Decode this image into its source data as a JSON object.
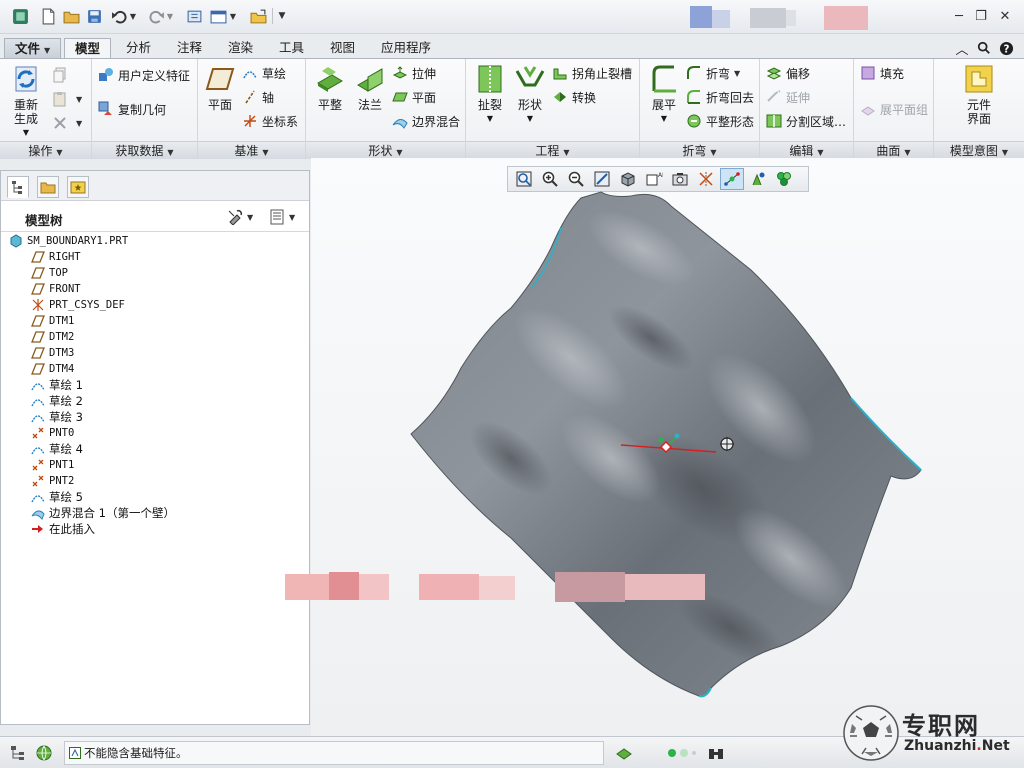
{
  "colors": {
    "accent_blue": "#2b6cb0",
    "surface_gray": "#6e747b",
    "edge_cyan": "#2ab2c8",
    "axis_red": "#d81e1e",
    "sketch_blue": "#2d7fc1",
    "plane_brown": "#8a5a1c",
    "datum_orange": "#c24a12"
  },
  "tabs": {
    "file": "文件",
    "items": [
      "模型",
      "分析",
      "注释",
      "渲染",
      "工具",
      "视图",
      "应用程序"
    ]
  },
  "ribbon": {
    "operations": {
      "label": "操作",
      "regen": "重新生成"
    },
    "get_data": {
      "label": "获取数据",
      "user_defined_feature": "用户定义特征",
      "copy_geometry": "复制几何"
    },
    "datum": {
      "label": "基准",
      "plane": "平面",
      "sketch": "草绘",
      "axis": "轴",
      "csys": "坐标系"
    },
    "shape": {
      "label": "形状",
      "flat": "平整",
      "flange": "法兰",
      "extrude": "拉伸",
      "plane": "平面",
      "boundary_blend": "边界混合"
    },
    "engineering": {
      "label": "工程",
      "rip": "扯裂",
      "form": "形状",
      "corner_relief": "拐角止裂槽",
      "convert": "转换"
    },
    "bend": {
      "label": "折弯",
      "unbend": "展平",
      "bend": "折弯",
      "bend_back": "折弯回去",
      "flat_state": "平整形态"
    },
    "editing": {
      "label": "编辑",
      "offset": "偏移",
      "extend": "延伸",
      "split_area": "分割区域…"
    },
    "surfaces": {
      "label": "曲面",
      "fill": "填充",
      "flatten_quilt": "展平面组"
    },
    "model_intent": {
      "label": "模型意图",
      "component_interface": "元件界面"
    }
  },
  "model_tree": {
    "title": "模型树",
    "items": [
      {
        "label": "SM_BOUNDARY1.PRT",
        "icon": "part-icon"
      },
      {
        "label": "RIGHT",
        "icon": "datum-plane-icon"
      },
      {
        "label": "TOP",
        "icon": "datum-plane-icon"
      },
      {
        "label": "FRONT",
        "icon": "datum-plane-icon"
      },
      {
        "label": "PRT_CSYS_DEF",
        "icon": "csys-icon"
      },
      {
        "label": "DTM1",
        "icon": "datum-plane-icon"
      },
      {
        "label": "DTM2",
        "icon": "datum-plane-icon"
      },
      {
        "label": "DTM3",
        "icon": "datum-plane-icon"
      },
      {
        "label": "DTM4",
        "icon": "datum-plane-icon"
      },
      {
        "label": "草绘 1",
        "icon": "sketch-icon"
      },
      {
        "label": "草绘 2",
        "icon": "sketch-icon"
      },
      {
        "label": "草绘 3",
        "icon": "sketch-icon"
      },
      {
        "label": "PNT0",
        "icon": "datum-point-icon"
      },
      {
        "label": "草绘 4",
        "icon": "sketch-icon"
      },
      {
        "label": "PNT1",
        "icon": "datum-point-icon"
      },
      {
        "label": "PNT2",
        "icon": "datum-point-icon"
      },
      {
        "label": "草绘 5",
        "icon": "sketch-icon"
      },
      {
        "label": "边界混合 1（第一个壁）",
        "icon": "boundary-blend-icon"
      },
      {
        "label": "在此插入",
        "icon": "insert-here-icon"
      }
    ]
  },
  "status": {
    "message": "不能隐含基础特征。"
  },
  "watermark": {
    "cn": "专职网",
    "en_prefix": "Zhuanzhi",
    "en_dot": ".",
    "en_suffix": "Net"
  }
}
